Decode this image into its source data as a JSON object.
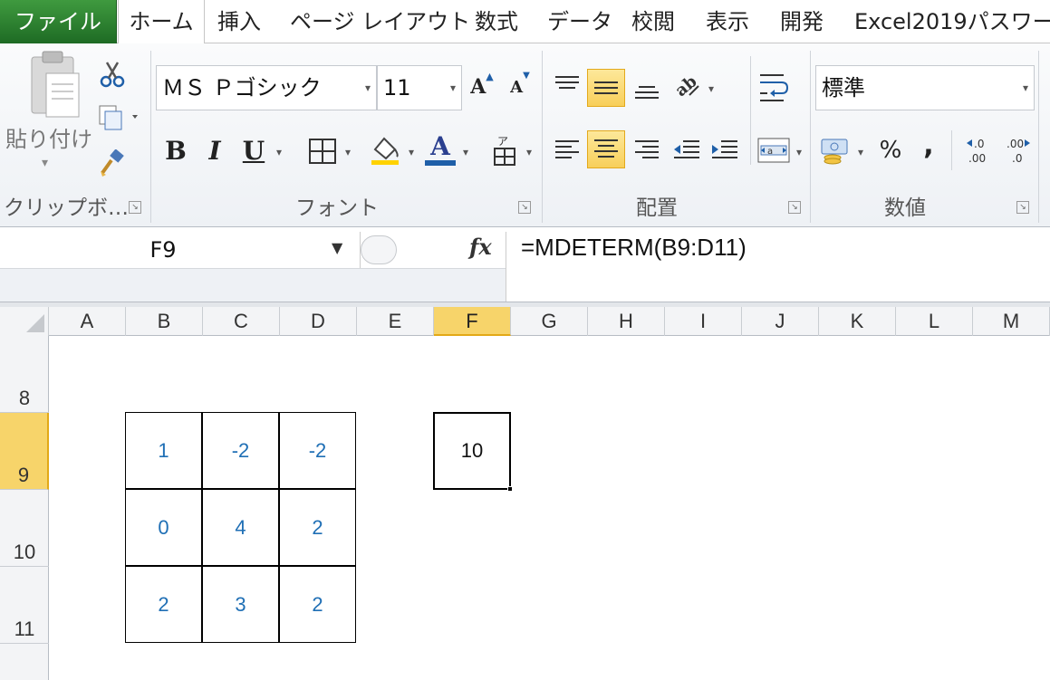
{
  "tabs": {
    "file": "ファイル",
    "items": [
      "ホーム",
      "挿入",
      "ページ レイアウト",
      "数式",
      "データ",
      "校閲",
      "表示",
      "開発",
      "Excel2019パスワー"
    ]
  },
  "ribbon": {
    "clipboard": {
      "paste_label": "貼り付け",
      "paste_arrow": "▾",
      "group_label": "クリップボ…"
    },
    "font": {
      "family": "ＭＳ Ｐゴシック",
      "size": "11",
      "bold": "B",
      "italic": "I",
      "underline": "U",
      "font_color_glyph": "A",
      "group_label": "フォント"
    },
    "alignment": {
      "group_label": "配置"
    },
    "number": {
      "format": "標準",
      "percent": "%",
      "comma": ",",
      "group_label": "数値"
    }
  },
  "formula_bar": {
    "name_box": "F9",
    "fx": "fx",
    "formula": "=MDETERM(B9:D11)"
  },
  "grid": {
    "columns": [
      "A",
      "B",
      "C",
      "D",
      "E",
      "F",
      "G",
      "H",
      "I",
      "J",
      "K",
      "L",
      "M"
    ],
    "selected_column": "F",
    "rows": [
      "8",
      "9",
      "10",
      "11"
    ],
    "selected_row": "9",
    "matrix": [
      [
        "1",
        "-2",
        "-2"
      ],
      [
        "0",
        "4",
        "2"
      ],
      [
        "2",
        "3",
        "2"
      ]
    ],
    "result_cell": {
      "address": "F9",
      "value": "10"
    }
  },
  "colors": {
    "file_tab": "#2e7d32",
    "highlight": "#f8cf5a",
    "matrix_text": "#1f6fb5"
  }
}
